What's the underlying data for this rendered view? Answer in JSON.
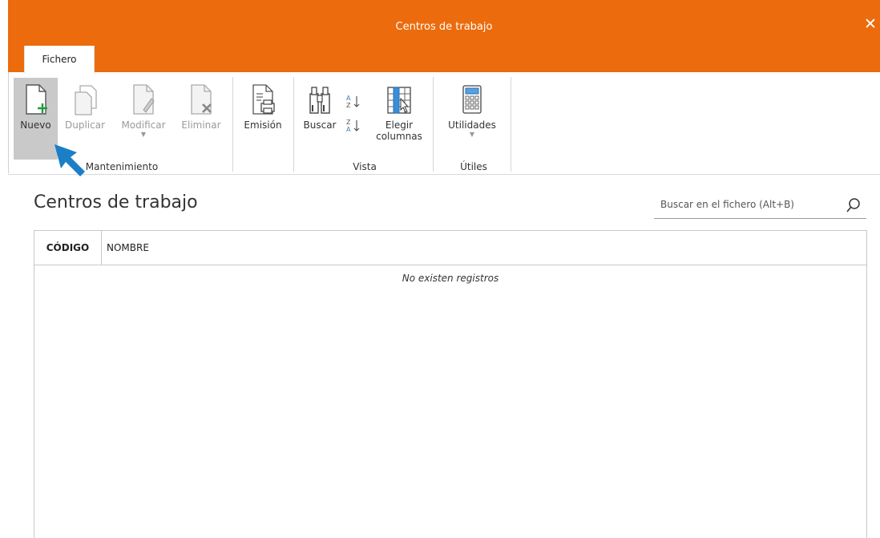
{
  "window": {
    "title": "Centros de trabajo",
    "close_label": "✕"
  },
  "tabs": [
    {
      "label": "Fichero"
    }
  ],
  "ribbon": {
    "groups": {
      "mantenimiento": "Mantenimiento",
      "vista": "Vista",
      "utiles": "Útiles"
    },
    "buttons": {
      "nuevo": "Nuevo",
      "duplicar": "Duplicar",
      "modificar": "Modificar",
      "eliminar": "Eliminar",
      "emision": "Emisión",
      "buscar": "Buscar",
      "elegir": "Elegir",
      "columnas": "columnas",
      "utilidades": "Utilidades"
    }
  },
  "page": {
    "title": "Centros de trabajo"
  },
  "search": {
    "placeholder": "Buscar en el fichero (Alt+B)"
  },
  "table": {
    "columns": [
      "CÓDIGO",
      "NOMBRE"
    ],
    "empty_message": "No existen registros"
  },
  "colors": {
    "accent": "#ec6b0c",
    "active_button": "#c9c9c9",
    "cursor": "#1a7fc6",
    "plus": "#1e9e3a"
  }
}
